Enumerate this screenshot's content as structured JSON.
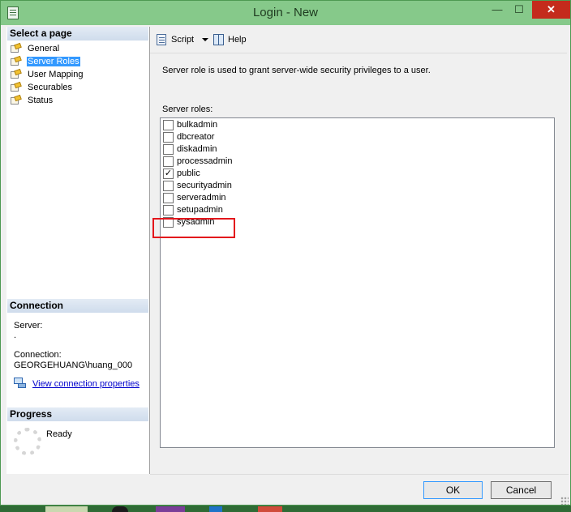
{
  "window": {
    "title": "Login - New",
    "minimize_glyph": "—",
    "maximize_glyph": "☐",
    "close_glyph": "✕"
  },
  "left": {
    "select_page_header": "Select a page",
    "pages": [
      "General",
      "Server Roles",
      "User Mapping",
      "Securables",
      "Status"
    ],
    "selected_page": "Server Roles",
    "connection_header": "Connection",
    "server_label": "Server:",
    "server_value": ".",
    "connection_label": "Connection:",
    "connection_value": "GEORGEHUANG\\huang_000",
    "view_connection_link": "View connection properties",
    "progress_header": "Progress",
    "progress_status": "Ready"
  },
  "toolbar": {
    "script_label": "Script",
    "help_label": "Help"
  },
  "main": {
    "description": "Server role is used to grant server-wide security privileges to a user.",
    "roles_label": "Server roles:",
    "roles": [
      {
        "name": "bulkadmin",
        "checked": false
      },
      {
        "name": "dbcreator",
        "checked": false
      },
      {
        "name": "diskadmin",
        "checked": false
      },
      {
        "name": "processadmin",
        "checked": false
      },
      {
        "name": "public",
        "checked": true
      },
      {
        "name": "securityadmin",
        "checked": false
      },
      {
        "name": "serveradmin",
        "checked": false
      },
      {
        "name": "setupadmin",
        "checked": false
      },
      {
        "name": "sysadmin",
        "checked": false
      }
    ],
    "highlighted_role": "sysadmin",
    "highlight_color": "#e3161c"
  },
  "buttons": {
    "ok": "OK",
    "cancel": "Cancel"
  },
  "colors": {
    "titlebar": "#86c98a",
    "close_button": "#c42b1c",
    "selection": "#3399ff"
  }
}
